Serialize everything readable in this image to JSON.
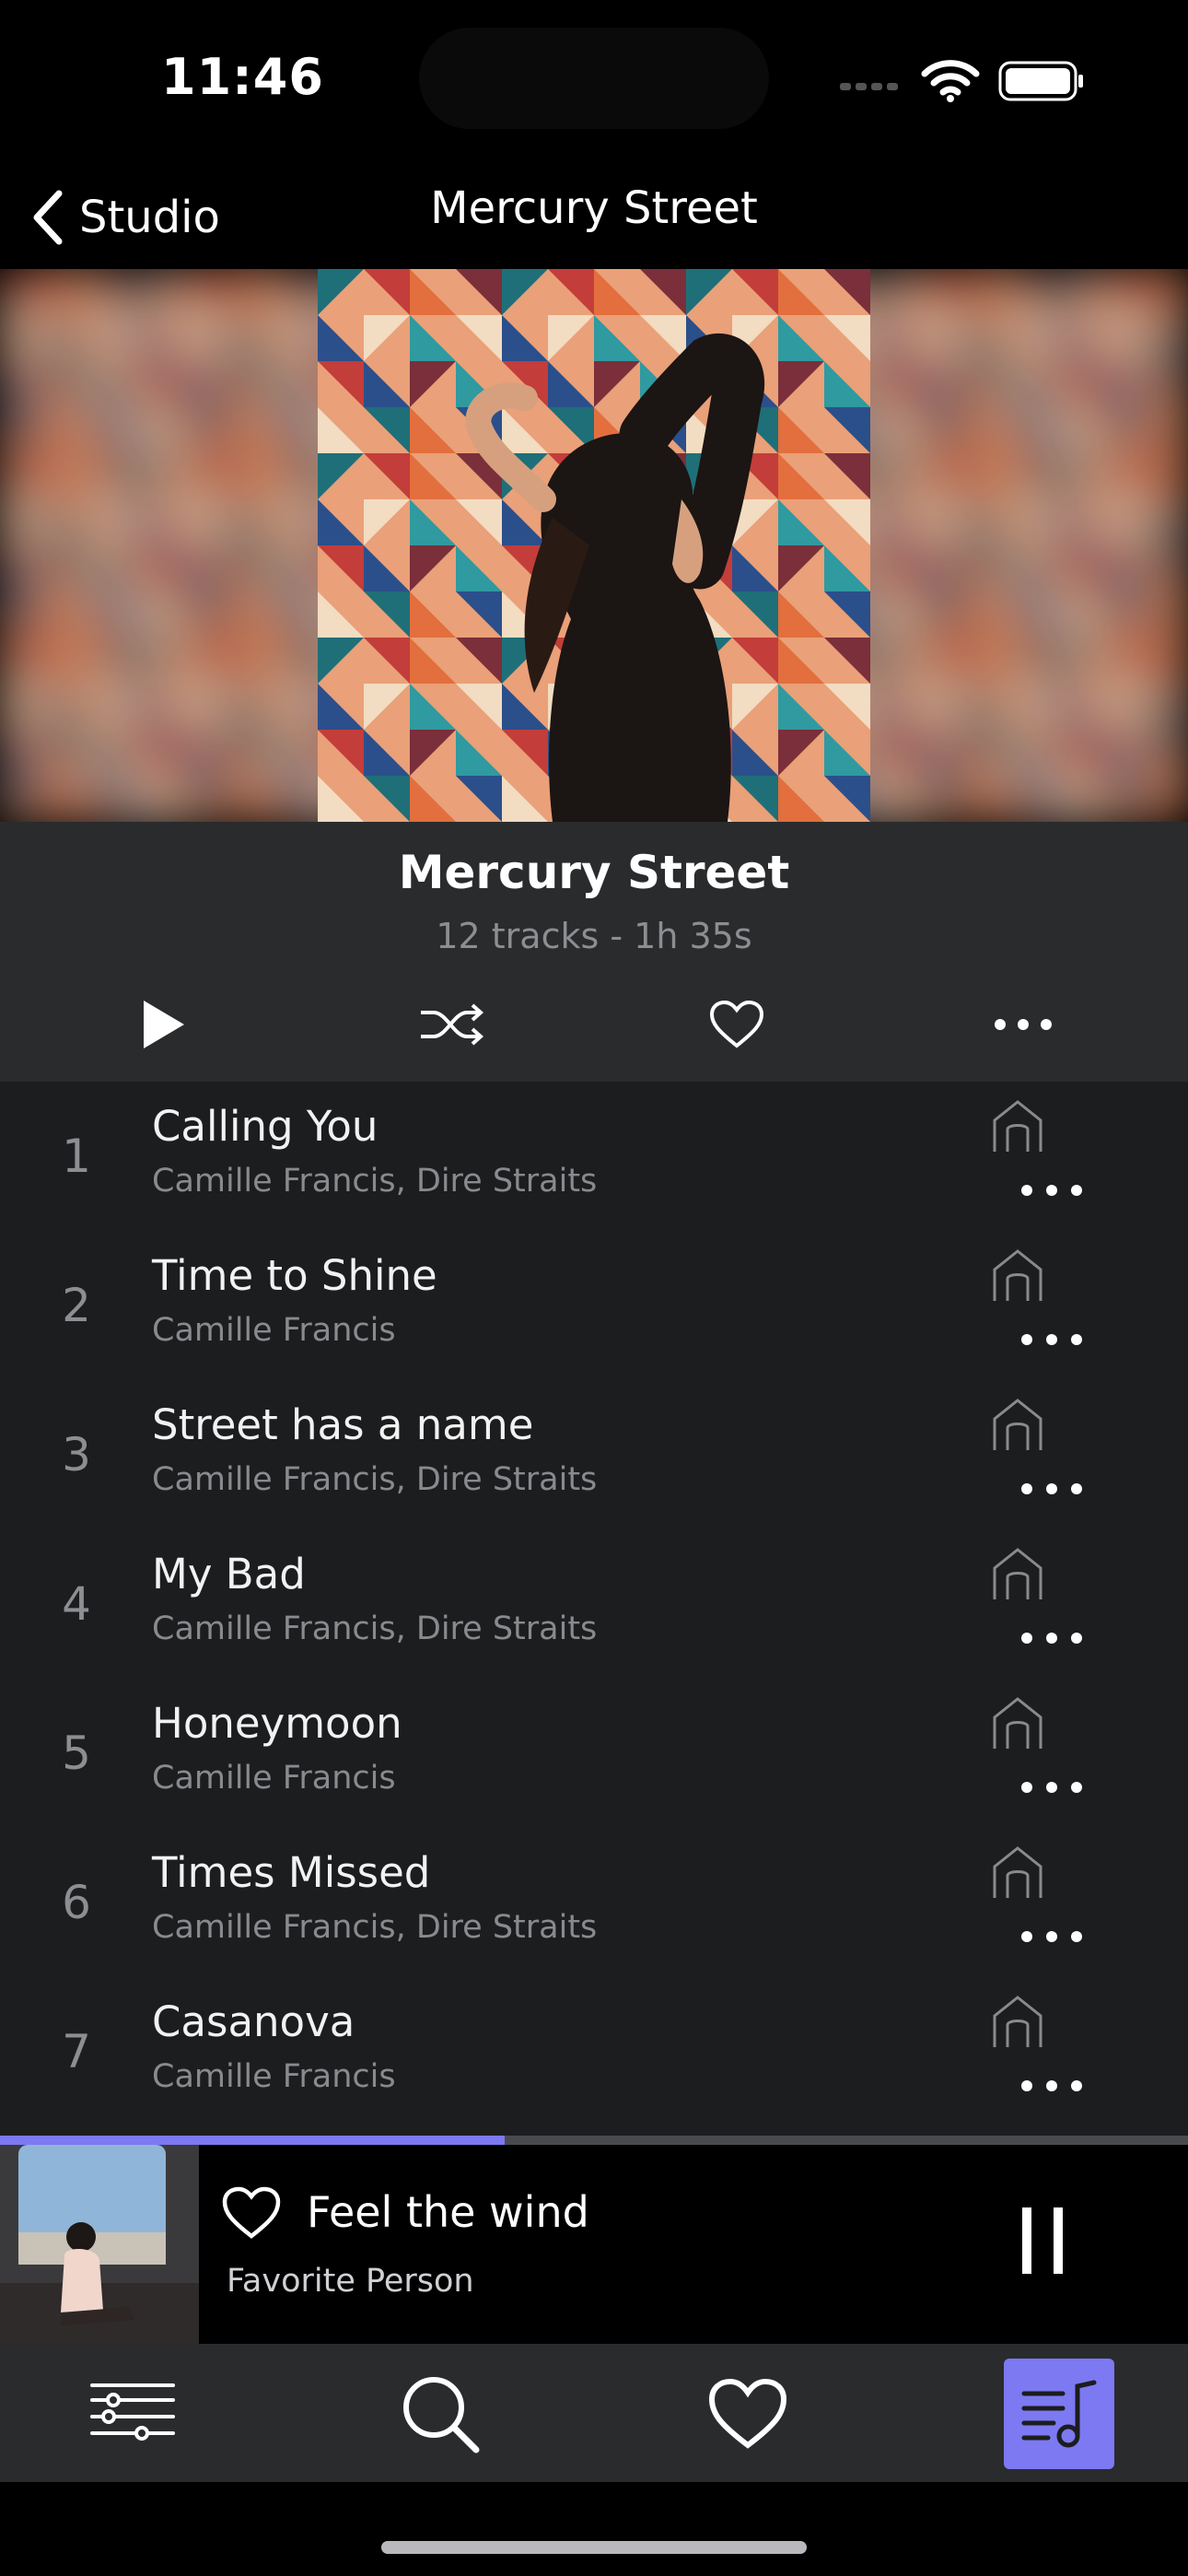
{
  "status_bar": {
    "time": "11:46"
  },
  "nav": {
    "back_label": "Studio",
    "title": "Mercury Street"
  },
  "album": {
    "title": "Mercury Street",
    "meta": "12 tracks - 1h 35s"
  },
  "controls": {
    "play_icon": "play-icon",
    "shuffle_icon": "shuffle-icon",
    "like_icon": "heart-icon",
    "more_icon": "more-icon"
  },
  "tracks": [
    {
      "number": "1",
      "title": "Calling You",
      "artist": "Camille Francis, Dire Straits"
    },
    {
      "number": "2",
      "title": "Time to Shine",
      "artist": "Camille Francis"
    },
    {
      "number": "3",
      "title": "Street has a name",
      "artist": "Camille Francis, Dire Straits"
    },
    {
      "number": "4",
      "title": "My Bad",
      "artist": "Camille Francis, Dire Straits"
    },
    {
      "number": "5",
      "title": "Honeymoon",
      "artist": "Camille Francis"
    },
    {
      "number": "6",
      "title": "Times Missed",
      "artist": "Camille Francis, Dire Straits"
    },
    {
      "number": "7",
      "title": "Casanova",
      "artist": "Camille Francis"
    }
  ],
  "now_playing": {
    "title": "Feel the wind",
    "artist": "Favorite Person",
    "progress": 0.425
  },
  "tabs": [
    "equalizer-icon",
    "search-icon",
    "heart-icon",
    "playlist-icon"
  ],
  "colors": {
    "accent": "#7c79f2",
    "panel": "#2a2b2d",
    "list_bg": "#1c1d1f"
  }
}
